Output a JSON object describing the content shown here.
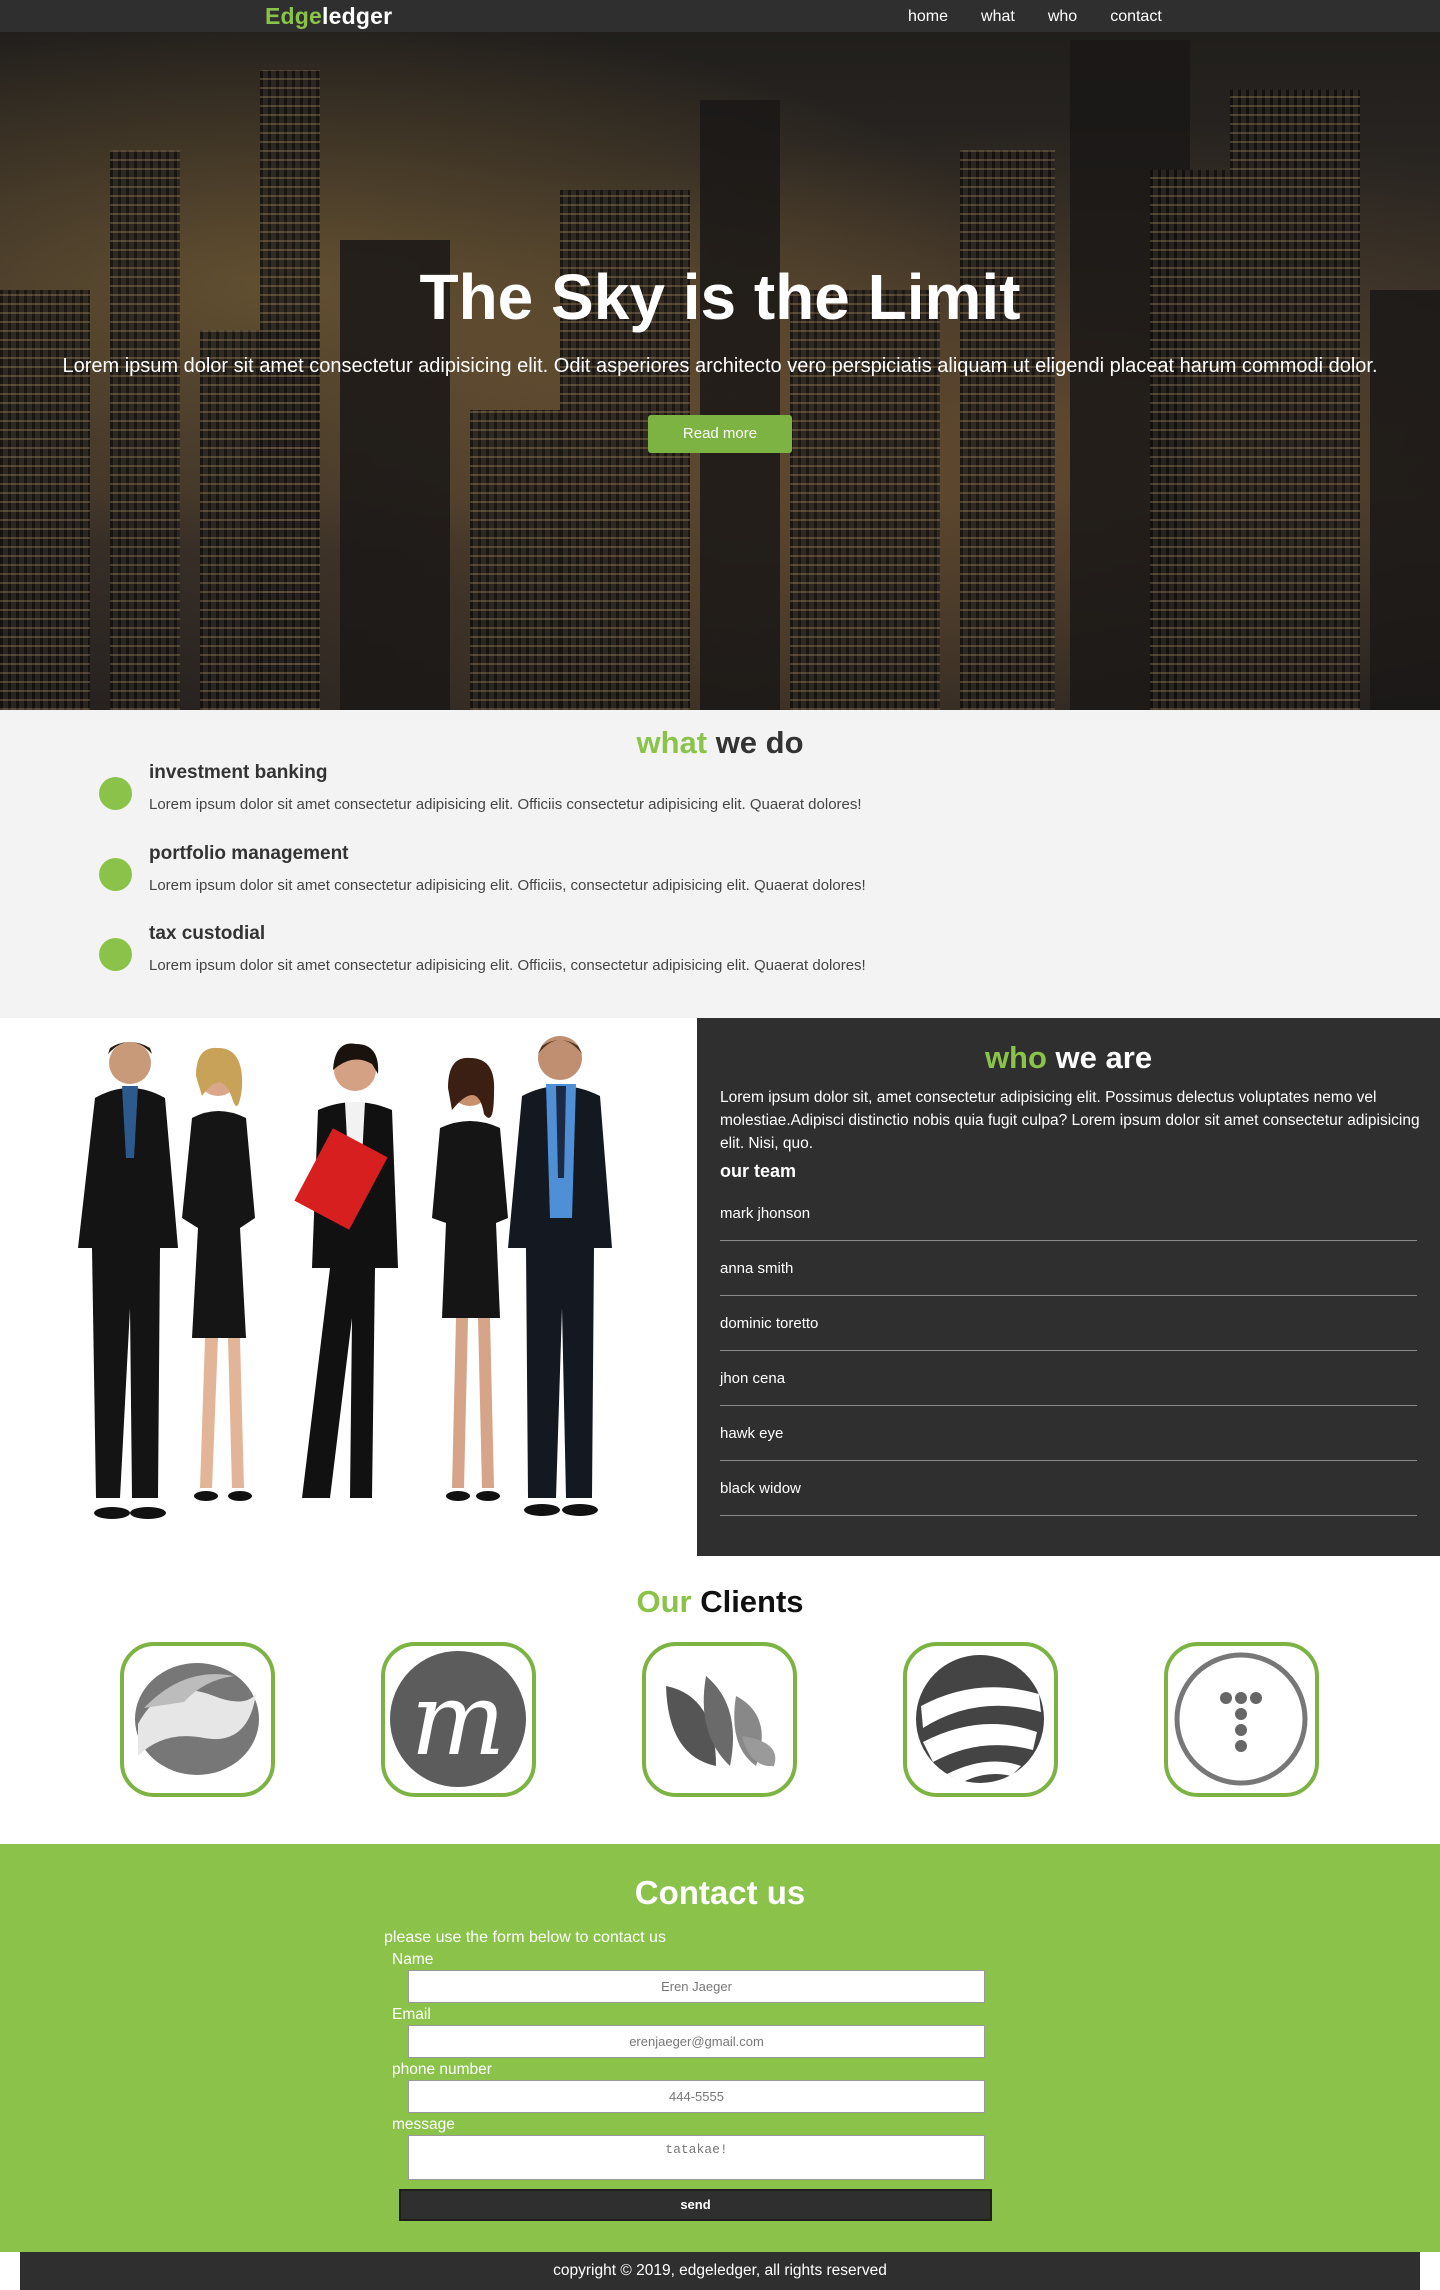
{
  "nav": {
    "logo_accent": "Edge",
    "logo_rest": "ledger",
    "links": [
      "home",
      "what",
      "who",
      "contact"
    ]
  },
  "hero": {
    "title": "The Sky is the Limit",
    "text": "Lorem ipsum dolor sit amet consectetur adipisicing elit. Odit asperiores architecto vero perspiciatis aliquam ut eligendi placeat harum commodi dolor.",
    "button": "Read more"
  },
  "what": {
    "title_accent": "what",
    "title_rest": " we do",
    "services": [
      {
        "name": "investment banking",
        "desc": "Lorem ipsum dolor sit amet consectetur adipisicing elit. Officiis consectetur adipisicing elit. Quaerat dolores!"
      },
      {
        "name": "portfolio management",
        "desc": "Lorem ipsum dolor sit amet consectetur adipisicing elit. Officiis, consectetur adipisicing elit. Quaerat dolores!"
      },
      {
        "name": "tax custodial",
        "desc": "Lorem ipsum dolor sit amet consectetur adipisicing elit. Officiis, consectetur adipisicing elit. Quaerat dolores!"
      }
    ]
  },
  "who": {
    "title_accent": "who",
    "title_rest": " we are",
    "text": "Lorem ipsum dolor sit, amet consectetur adipisicing elit. Possimus delectus voluptates nemo vel molestiae.Adipisci distinctio nobis quia fugit culpa? Lorem ipsum dolor sit amet consectetur adipisicing elit. Nisi, quo.",
    "team_heading": "our team",
    "team": [
      "mark jhonson",
      "anna smith",
      "dominic toretto",
      "jhon cena",
      "hawk eye",
      "black widow"
    ]
  },
  "clients": {
    "title_accent": "Our",
    "title_rest": " Clients"
  },
  "contact": {
    "title": "Contact us",
    "subtitle": "please use the form below to contact us",
    "name_label": "Name",
    "name_value": "Eren Jaeger",
    "email_label": "Email",
    "email_value": "erenjaeger@gmail.com",
    "phone_label": "phone number",
    "phone_value": "444-5555",
    "message_label": "message",
    "message_value": "tatakae!",
    "send": "send"
  },
  "footer": {
    "text": "copyright © 2019, edgeledger, all rights reserved"
  },
  "colors": {
    "accent": "#8bc34a",
    "dark": "#2f2f2f",
    "button_green": "#7cb342"
  }
}
